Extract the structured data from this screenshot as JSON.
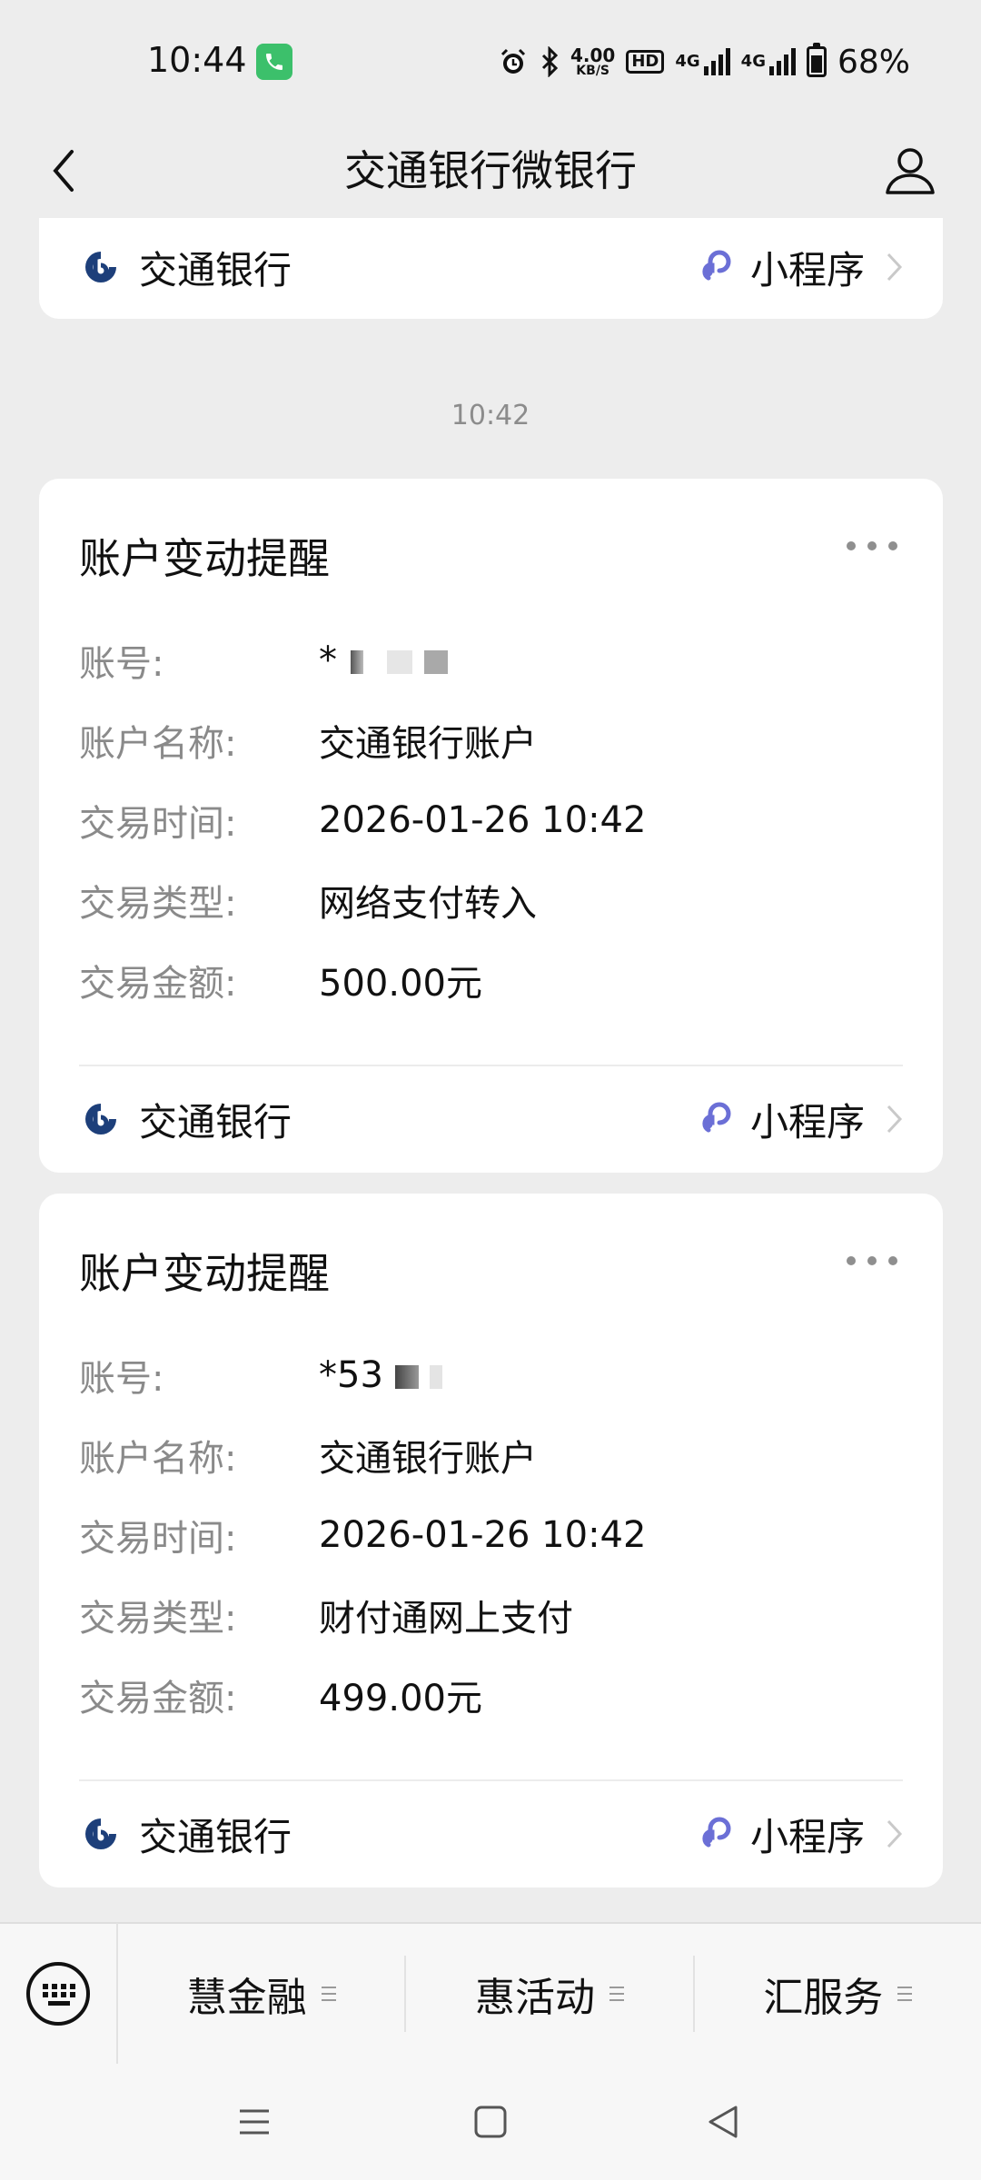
{
  "status_bar": {
    "time": "10:44",
    "call_icon": "phone-icon",
    "speed_value": "4.00",
    "speed_unit": "KB/S",
    "hd_label": "HD",
    "net_label_1": "4G",
    "net_label_2": "4G",
    "battery": "68%"
  },
  "header": {
    "title": "交通银行微银行",
    "back_icon": "chevron-left-icon",
    "profile_icon": "user-icon"
  },
  "top_card": {
    "bank_name": "交通银行",
    "mini_program_label": "小程序"
  },
  "timestamp": "10:42",
  "messages": [
    {
      "title": "账户变动提醒",
      "fields": [
        {
          "label": "账号:",
          "value": "*"
        },
        {
          "label": "账户名称:",
          "value": "交通银行账户"
        },
        {
          "label": "交易时间:",
          "value": "2026-01-26 10:42"
        },
        {
          "label": "交易类型:",
          "value": "网络支付转入"
        },
        {
          "label": "交易金额:",
          "value": "500.00元"
        }
      ],
      "bank_name": "交通银行",
      "mini_program_label": "小程序"
    },
    {
      "title": "账户变动提醒",
      "fields": [
        {
          "label": "账号:",
          "value": "*53"
        },
        {
          "label": "账户名称:",
          "value": "交通银行账户"
        },
        {
          "label": "交易时间:",
          "value": "2026-01-26 10:42"
        },
        {
          "label": "交易类型:",
          "value": "财付通网上支付"
        },
        {
          "label": "交易金额:",
          "value": "499.00元"
        }
      ],
      "bank_name": "交通银行",
      "mini_program_label": "小程序"
    }
  ],
  "bottom_menu": {
    "keyboard_icon": "keyboard-icon",
    "items": [
      "慧金融",
      "惠活动",
      "汇服务"
    ]
  },
  "colors": {
    "background": "#ededed",
    "card": "#ffffff",
    "bank_blue": "#1d3f7a",
    "mini_program_purple": "#6b6fd6",
    "label_gray": "#8a8a8a"
  }
}
